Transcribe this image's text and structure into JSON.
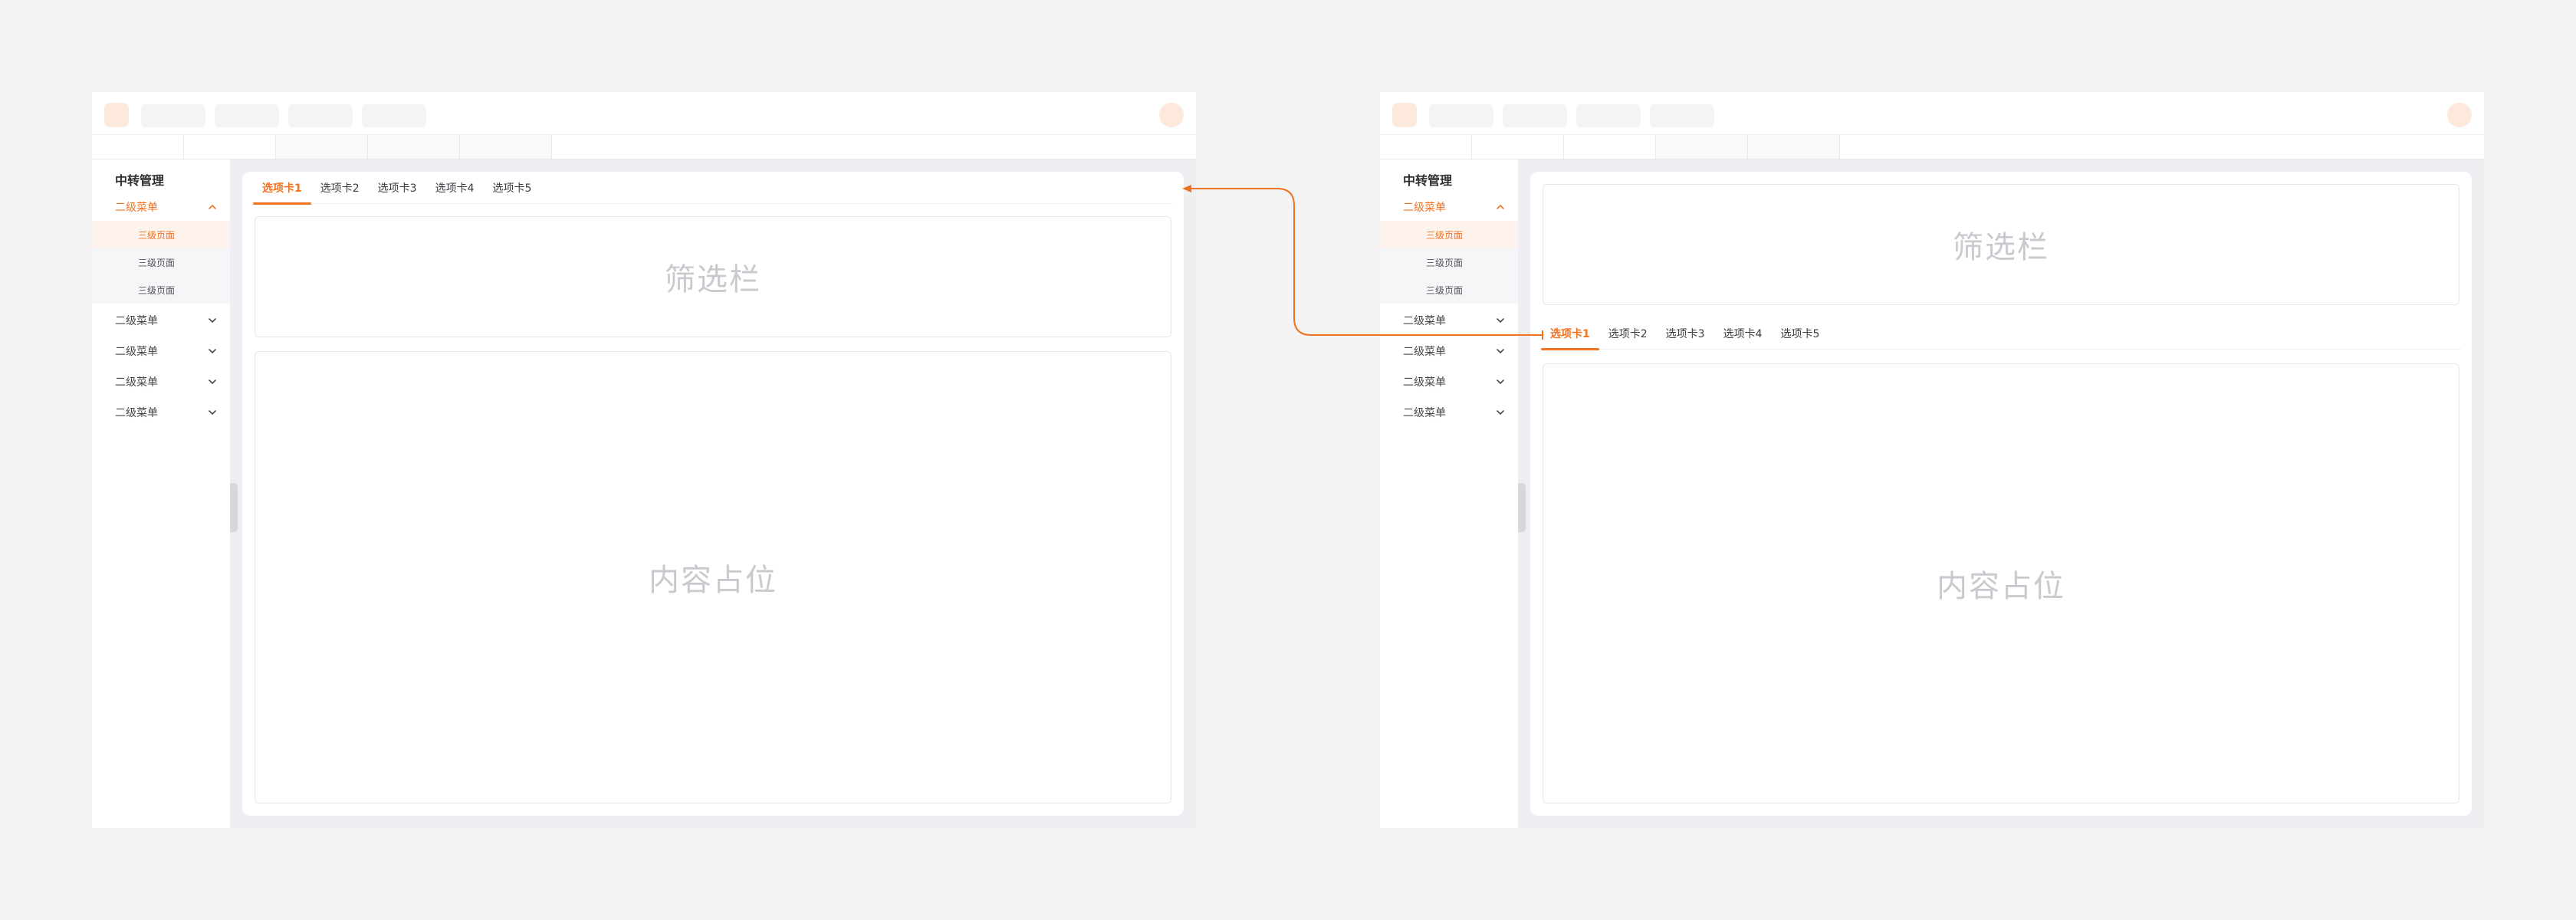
{
  "colors": {
    "accent": "#f07322",
    "page_bg": "#f3f3f3",
    "frame_bg": "#eeeff3",
    "placeholder_text": "#c9cacf"
  },
  "left": {
    "sidebar": {
      "title": "中转管理",
      "items": [
        {
          "label": "二级菜单",
          "icon": "chevron-up-icon",
          "active": true
        },
        {
          "label": "二级菜单",
          "icon": "chevron-down-icon"
        },
        {
          "label": "二级菜单",
          "icon": "chevron-down-icon"
        },
        {
          "label": "二级菜单",
          "icon": "chevron-down-icon"
        },
        {
          "label": "二级菜单",
          "icon": "chevron-down-icon"
        }
      ],
      "sub_items": [
        {
          "label": "三级页面",
          "active": true
        },
        {
          "label": "三级页面"
        },
        {
          "label": "三级页面"
        }
      ]
    },
    "tabs": [
      "选项卡1",
      "选项卡2",
      "选项卡3",
      "选项卡4",
      "选项卡5"
    ],
    "filter_label": "筛选栏",
    "content_label": "内容占位"
  },
  "right": {
    "sidebar": {
      "title": "中转管理",
      "items": [
        {
          "label": "二级菜单",
          "icon": "chevron-up-icon",
          "active": true
        },
        {
          "label": "二级菜单",
          "icon": "chevron-down-icon"
        },
        {
          "label": "二级菜单",
          "icon": "chevron-down-icon"
        },
        {
          "label": "二级菜单",
          "icon": "chevron-down-icon"
        },
        {
          "label": "二级菜单",
          "icon": "chevron-down-icon"
        }
      ],
      "sub_items": [
        {
          "label": "三级页面",
          "active": true
        },
        {
          "label": "三级页面"
        },
        {
          "label": "三级页面"
        }
      ]
    },
    "tabs": [
      "选项卡1",
      "选项卡2",
      "选项卡3",
      "选项卡4",
      "选项卡5"
    ],
    "filter_label": "筛选栏",
    "content_label": "内容占位"
  }
}
